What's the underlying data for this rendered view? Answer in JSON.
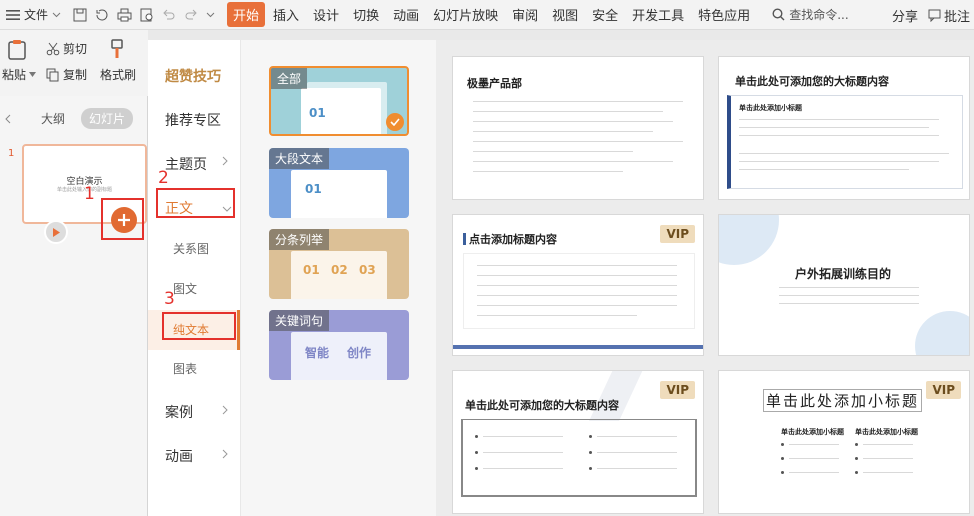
{
  "menubar": {
    "file": "文件",
    "tabs": [
      "开始",
      "插入",
      "设计",
      "切换",
      "动画",
      "幻灯片放映",
      "审阅",
      "视图",
      "安全",
      "开发工具",
      "特色应用"
    ],
    "active_tab": "开始",
    "search": "查找命令...",
    "share": "分享",
    "annotate": "批注"
  },
  "ribbon": {
    "paste": "粘贴",
    "cut": "剪切",
    "copy": "复制",
    "format_painter": "格式刷"
  },
  "panel": {
    "tab_outline": "大纲",
    "tab_slides": "幻灯片",
    "slide_number": "1",
    "slide_title": "空白演示",
    "slide_subtitle": "单击此处输入你的副标题"
  },
  "annotations": [
    "1",
    "2",
    "3"
  ],
  "categories": {
    "head": "超赞技巧",
    "recommended": "推荐专区",
    "topic": "主题页",
    "body": "正文",
    "sub": [
      "关系图",
      "图文",
      "纯文本",
      "图表"
    ],
    "cases": "案例",
    "animation": "动画"
  },
  "styles": [
    {
      "label": "全部",
      "nums": "01"
    },
    {
      "label": "大段文本",
      "nums": "01"
    },
    {
      "label": "分条列举",
      "nums": [
        "01",
        "02",
        "03"
      ]
    },
    {
      "label": "关键词句",
      "words": [
        "智能",
        "创作"
      ]
    }
  ],
  "templates": [
    {
      "title": "极墨产品部",
      "vip": false
    },
    {
      "title": "单击此处可添加您的大标题内容",
      "subtitle": "单击此处添加小标题",
      "vip": false
    },
    {
      "title": "点击添加标题内容",
      "vip": true,
      "vip_label": "VIP"
    },
    {
      "title": "户外拓展训练目的",
      "vip": false
    },
    {
      "title": "单击此处可添加您的大标题内容",
      "vip": true,
      "vip_label": "VIP"
    },
    {
      "title": "单击此处添加小标题",
      "vip": true,
      "vip_label": "VIP",
      "sub_left": "单击此处添加小标题",
      "sub_right": "单击此处添加小标题"
    }
  ],
  "colors": {
    "accent": "#e8703a",
    "annotation_red": "#e4312c",
    "vip_bg": "#efdcbc"
  }
}
